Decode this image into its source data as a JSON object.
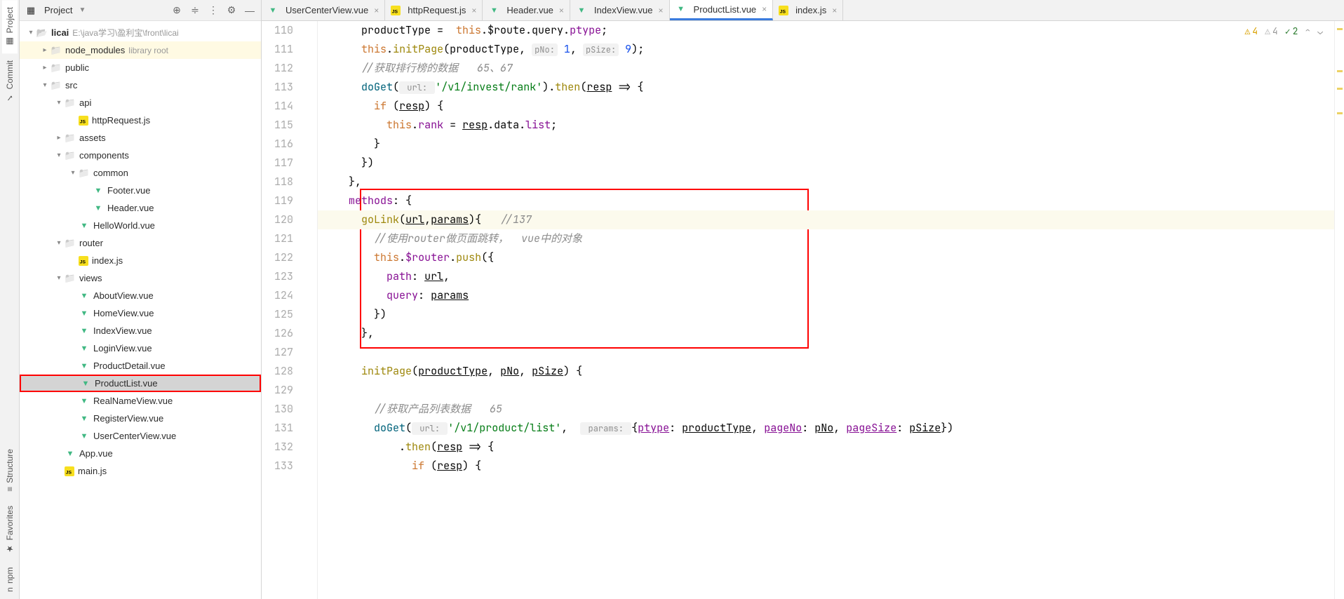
{
  "left_tools": {
    "project": "Project",
    "commit": "Commit",
    "structure": "Structure",
    "favorites": "Favorites",
    "npm": "npm"
  },
  "project_header": {
    "title": "Project"
  },
  "tree": {
    "root_name": "licai",
    "root_path": "E:\\java学习\\盈利宝\\front\\licai",
    "node_modules": "node_modules",
    "node_modules_hint": "library root",
    "public": "public",
    "src": "src",
    "api": "api",
    "httpRequest": "httpRequest.js",
    "assets": "assets",
    "components": "components",
    "common": "common",
    "footer": "Footer.vue",
    "header": "Header.vue",
    "helloworld": "HelloWorld.vue",
    "router": "router",
    "router_index": "index.js",
    "views": "views",
    "about": "AboutView.vue",
    "home": "HomeView.vue",
    "indexv": "IndexView.vue",
    "login": "LoginView.vue",
    "productdetail": "ProductDetail.vue",
    "productlist": "ProductList.vue",
    "realname": "RealNameView.vue",
    "register": "RegisterView.vue",
    "usercenter": "UserCenterView.vue",
    "app": "App.vue",
    "mainjs": "main.js"
  },
  "tabs": [
    {
      "label": "UserCenterView.vue",
      "icon": "vue"
    },
    {
      "label": "httpRequest.js",
      "icon": "js"
    },
    {
      "label": "Header.vue",
      "icon": "vue"
    },
    {
      "label": "IndexView.vue",
      "icon": "vue"
    },
    {
      "label": "ProductList.vue",
      "icon": "vue",
      "active": true
    },
    {
      "label": "index.js",
      "icon": "js"
    }
  ],
  "badges": {
    "warn4": "4",
    "grey4": "4",
    "ok2": "2"
  },
  "code": {
    "lines": [
      {
        "n": 110,
        "segments": [
          {
            "t": "      productType =  ",
            "c": "kw-default"
          },
          {
            "t": "this",
            "c": "kw-orange"
          },
          {
            "t": ".$route.query.",
            "c": "kw-default"
          },
          {
            "t": "ptype",
            "c": "kw-purple"
          },
          {
            "t": ";",
            "c": "kw-default"
          }
        ]
      },
      {
        "n": 111,
        "segments": [
          {
            "t": "      ",
            "c": ""
          },
          {
            "t": "this",
            "c": "kw-orange"
          },
          {
            "t": ".",
            "c": "kw-default"
          },
          {
            "t": "initPage",
            "c": "kw-brown"
          },
          {
            "t": "(productType, ",
            "c": "kw-default"
          },
          {
            "t": "pNo:",
            "c": "hint-box"
          },
          {
            "t": " ",
            "c": ""
          },
          {
            "t": "1",
            "c": "kw-navy"
          },
          {
            "t": ", ",
            "c": "kw-default"
          },
          {
            "t": "pSize:",
            "c": "hint-box"
          },
          {
            "t": " ",
            "c": ""
          },
          {
            "t": "9",
            "c": "kw-navy"
          },
          {
            "t": ");",
            "c": "kw-default"
          }
        ]
      },
      {
        "n": 112,
        "segments": [
          {
            "t": "      ",
            "c": ""
          },
          {
            "t": "//获取排行榜的数据   65、67",
            "c": "kw-grey"
          }
        ]
      },
      {
        "n": 113,
        "segments": [
          {
            "t": "      ",
            "c": ""
          },
          {
            "t": "doGet",
            "c": "kw-teal"
          },
          {
            "t": "(",
            "c": "kw-default"
          },
          {
            "t": " url: ",
            "c": "hint-box"
          },
          {
            "t": "'/v1/invest/rank'",
            "c": "kw-green"
          },
          {
            "t": ").",
            "c": "kw-default"
          },
          {
            "t": "then",
            "c": "kw-brown"
          },
          {
            "t": "(",
            "c": "kw-default"
          },
          {
            "t": "resp",
            "c": "kw-default underline"
          },
          {
            "t": " => {",
            "c": "kw-default"
          }
        ]
      },
      {
        "n": 114,
        "segments": [
          {
            "t": "        ",
            "c": ""
          },
          {
            "t": "if",
            "c": "kw-orange"
          },
          {
            "t": " (",
            "c": "kw-default"
          },
          {
            "t": "resp",
            "c": "kw-default underline"
          },
          {
            "t": ") {",
            "c": "kw-default"
          }
        ]
      },
      {
        "n": 115,
        "segments": [
          {
            "t": "          ",
            "c": ""
          },
          {
            "t": "this",
            "c": "kw-orange"
          },
          {
            "t": ".",
            "c": "kw-default"
          },
          {
            "t": "rank",
            "c": "kw-purple"
          },
          {
            "t": " = ",
            "c": "kw-default"
          },
          {
            "t": "resp",
            "c": "kw-default underline"
          },
          {
            "t": ".data.",
            "c": "kw-default"
          },
          {
            "t": "list",
            "c": "kw-purple"
          },
          {
            "t": ";",
            "c": "kw-default"
          }
        ]
      },
      {
        "n": 116,
        "segments": [
          {
            "t": "        }",
            "c": "kw-default"
          }
        ]
      },
      {
        "n": 117,
        "segments": [
          {
            "t": "      })",
            "c": "kw-default"
          }
        ]
      },
      {
        "n": 118,
        "segments": [
          {
            "t": "    },",
            "c": "kw-default"
          }
        ]
      },
      {
        "n": 119,
        "segments": [
          {
            "t": "    ",
            "c": ""
          },
          {
            "t": "methods",
            "c": "kw-purple"
          },
          {
            "t": ": {",
            "c": "kw-default"
          }
        ]
      },
      {
        "n": 120,
        "hl": true,
        "segments": [
          {
            "t": "      ",
            "c": ""
          },
          {
            "t": "goLink",
            "c": "kw-brown"
          },
          {
            "t": "(",
            "c": "kw-default"
          },
          {
            "t": "url",
            "c": "kw-default underline"
          },
          {
            "t": ",",
            "c": "kw-default"
          },
          {
            "t": "params",
            "c": "kw-default underline"
          },
          {
            "t": "){   ",
            "c": "kw-default"
          },
          {
            "t": "//137",
            "c": "kw-grey"
          }
        ]
      },
      {
        "n": 121,
        "segments": [
          {
            "t": "        ",
            "c": ""
          },
          {
            "t": "//使用router做页面跳转，  vue中的对象",
            "c": "kw-grey"
          }
        ]
      },
      {
        "n": 122,
        "segments": [
          {
            "t": "        ",
            "c": ""
          },
          {
            "t": "this",
            "c": "kw-orange"
          },
          {
            "t": ".",
            "c": "kw-default"
          },
          {
            "t": "$router",
            "c": "kw-purple"
          },
          {
            "t": ".",
            "c": "kw-default"
          },
          {
            "t": "push",
            "c": "kw-brown"
          },
          {
            "t": "({",
            "c": "kw-default"
          }
        ]
      },
      {
        "n": 123,
        "segments": [
          {
            "t": "          ",
            "c": ""
          },
          {
            "t": "path",
            "c": "kw-purple"
          },
          {
            "t": ": ",
            "c": "kw-default"
          },
          {
            "t": "url",
            "c": "kw-default underline"
          },
          {
            "t": ",",
            "c": "kw-default"
          }
        ]
      },
      {
        "n": 124,
        "segments": [
          {
            "t": "          ",
            "c": ""
          },
          {
            "t": "query",
            "c": "kw-purple"
          },
          {
            "t": ": ",
            "c": "kw-default"
          },
          {
            "t": "params",
            "c": "kw-default underline"
          }
        ]
      },
      {
        "n": 125,
        "segments": [
          {
            "t": "        })",
            "c": "kw-default"
          }
        ]
      },
      {
        "n": 126,
        "segments": [
          {
            "t": "      },",
            "c": "kw-default"
          }
        ]
      },
      {
        "n": 127,
        "segments": [
          {
            "t": "",
            "c": ""
          }
        ]
      },
      {
        "n": 128,
        "segments": [
          {
            "t": "      ",
            "c": ""
          },
          {
            "t": "initPage",
            "c": "kw-brown"
          },
          {
            "t": "(",
            "c": "kw-default"
          },
          {
            "t": "productType",
            "c": "kw-default underline"
          },
          {
            "t": ", ",
            "c": "kw-default"
          },
          {
            "t": "pNo",
            "c": "kw-default underline"
          },
          {
            "t": ", ",
            "c": "kw-default"
          },
          {
            "t": "pSize",
            "c": "kw-default underline"
          },
          {
            "t": ") {",
            "c": "kw-default"
          }
        ]
      },
      {
        "n": 129,
        "segments": [
          {
            "t": "",
            "c": ""
          }
        ]
      },
      {
        "n": 130,
        "segments": [
          {
            "t": "        ",
            "c": ""
          },
          {
            "t": "//获取产品列表数据   65",
            "c": "kw-grey"
          }
        ]
      },
      {
        "n": 131,
        "segments": [
          {
            "t": "        ",
            "c": ""
          },
          {
            "t": "doGet",
            "c": "kw-teal"
          },
          {
            "t": "(",
            "c": "kw-default"
          },
          {
            "t": " url: ",
            "c": "hint-box"
          },
          {
            "t": "'/v1/product/list'",
            "c": "kw-green"
          },
          {
            "t": ",  ",
            "c": "kw-default"
          },
          {
            "t": " params: ",
            "c": "hint-box"
          },
          {
            "t": "{",
            "c": "kw-default"
          },
          {
            "t": "ptype",
            "c": "kw-purple underline"
          },
          {
            "t": ": ",
            "c": "kw-default"
          },
          {
            "t": "productType",
            "c": "kw-default underline"
          },
          {
            "t": ", ",
            "c": "kw-default"
          },
          {
            "t": "pageNo",
            "c": "kw-purple underline"
          },
          {
            "t": ": ",
            "c": "kw-default"
          },
          {
            "t": "pNo",
            "c": "kw-default underline"
          },
          {
            "t": ", ",
            "c": "kw-default"
          },
          {
            "t": "pageSize",
            "c": "kw-purple underline"
          },
          {
            "t": ": ",
            "c": "kw-default"
          },
          {
            "t": "pSize",
            "c": "kw-default underline"
          },
          {
            "t": "})",
            "c": "kw-default"
          }
        ]
      },
      {
        "n": 132,
        "segments": [
          {
            "t": "            .",
            "c": "kw-default"
          },
          {
            "t": "then",
            "c": "kw-brown"
          },
          {
            "t": "(",
            "c": "kw-default"
          },
          {
            "t": "resp",
            "c": "kw-default underline"
          },
          {
            "t": " => {",
            "c": "kw-default"
          }
        ]
      },
      {
        "n": 133,
        "segments": [
          {
            "t": "              ",
            "c": ""
          },
          {
            "t": "if",
            "c": "kw-orange"
          },
          {
            "t": " (",
            "c": "kw-default"
          },
          {
            "t": "resp",
            "c": "kw-default underline"
          },
          {
            "t": ") {",
            "c": "kw-default"
          }
        ]
      }
    ]
  }
}
